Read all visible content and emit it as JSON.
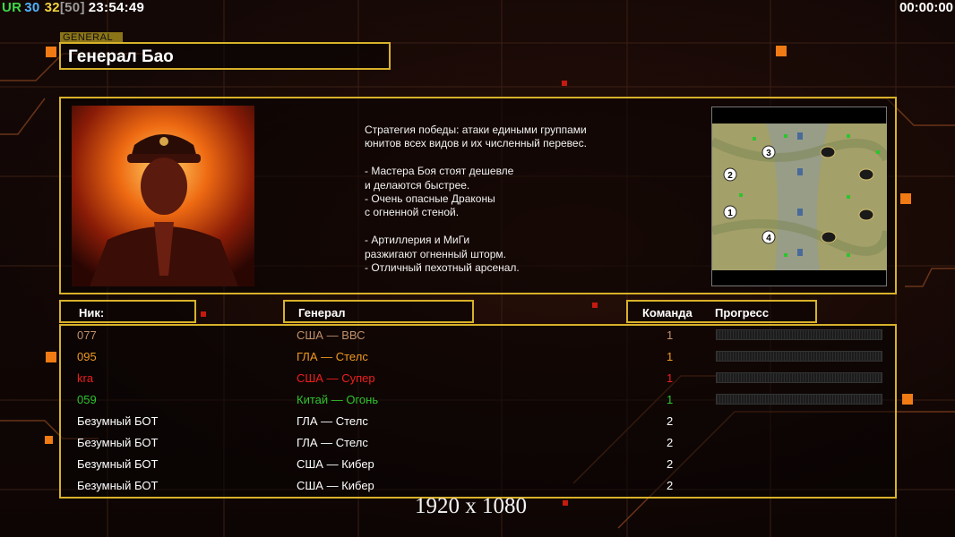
{
  "hud": {
    "fps_label": "UR",
    "fps_current": "30",
    "fps_max": "32",
    "fps_limit": "[50]",
    "clock": "23:54:49",
    "timer": "00:00:00"
  },
  "general": {
    "tab_label": "GENERAL",
    "name": "Генерал Бао",
    "description": "Стратегия победы: атаки едиными группами\nюнитов всех видов и их численный перевес.\n\n- Мастера Боя стоят дешевле\nи делаются быстрее.\n- Очень опасные Драконы\nс огненной стеной.\n\n- Артиллерия и МиГи\nразжигают огненный шторм.\n- Отличный пехотный арсенал."
  },
  "map": {
    "start_positions": [
      "3",
      "2",
      "1",
      "4"
    ]
  },
  "table": {
    "headers": {
      "nick": "Ник:",
      "general": "Генерал",
      "team": "Команда",
      "progress": "Прогресс"
    },
    "rows": [
      {
        "nick": "077",
        "general": "США — ВВС",
        "team": "1",
        "color": "#c0906a",
        "progress": true
      },
      {
        "nick": "095",
        "general": "ГЛА — Стелс",
        "team": "1",
        "color": "#f09a1e",
        "progress": true
      },
      {
        "nick": "kra",
        "general": "США — Супер",
        "team": "1",
        "color": "#f01e1e",
        "progress": true
      },
      {
        "nick": "059",
        "general": "Китай — Огонь",
        "team": "1",
        "color": "#2ec42e",
        "progress": true
      },
      {
        "nick": "Безумный БОТ",
        "general": "ГЛА — Стелс",
        "team": "2",
        "color": "#ffffff",
        "progress": false
      },
      {
        "nick": "Безумный БОТ",
        "general": "ГЛА — Стелс",
        "team": "2",
        "color": "#ffffff",
        "progress": false
      },
      {
        "nick": "Безумный БОТ",
        "general": "США — Кибер",
        "team": "2",
        "color": "#ffffff",
        "progress": false
      },
      {
        "nick": "Безумный БОТ",
        "general": "США — Кибер",
        "team": "2",
        "color": "#ffffff",
        "progress": false
      }
    ]
  },
  "resolution": "1920 x 1080",
  "colors": {
    "frame": "#d8b12a",
    "accent_orange": "#f07a14",
    "accent_red": "#c51a10"
  }
}
